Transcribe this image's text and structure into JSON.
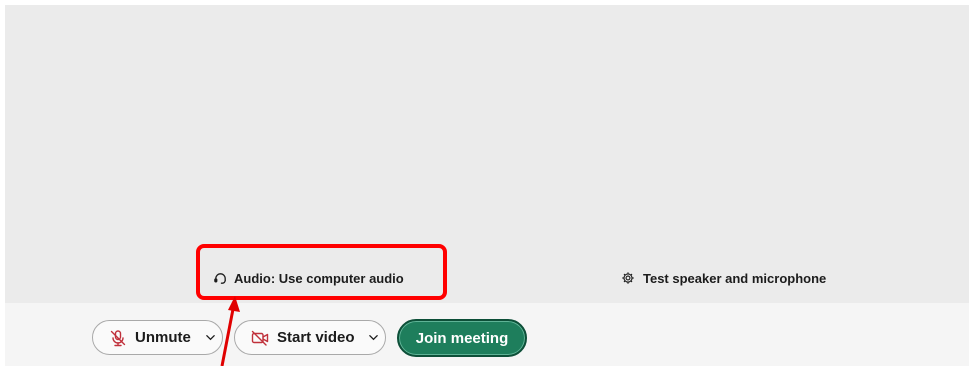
{
  "preview": {
    "audio_label": "Audio: Use computer audio",
    "test_label": "Test speaker and microphone"
  },
  "controls": {
    "unmute_label": "Unmute",
    "start_video_label": "Start video",
    "join_label": "Join meeting"
  },
  "icons": {
    "audio": "headset-icon",
    "test": "gear-icon",
    "mute": "muted-microphone-icon",
    "video": "video-off-icon",
    "chevron": "chevron-down-icon"
  },
  "colors": {
    "join_background": "#1e7e5c",
    "muted_icon": "#c0303b",
    "annotation": "#ff0000"
  }
}
